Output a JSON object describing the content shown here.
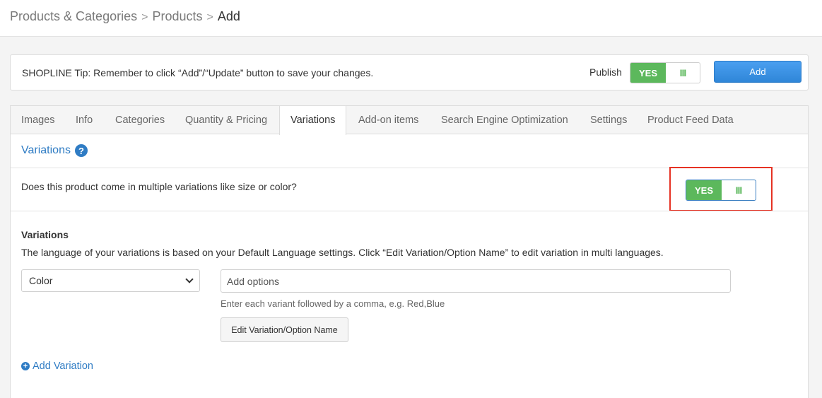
{
  "breadcrumb": {
    "items": [
      "Products & Categories",
      "Products"
    ],
    "current": "Add",
    "separator": ">"
  },
  "tip_bar": {
    "text": "SHOPLINE Tip: Remember to click “Add”/“Update” button to save your changes.",
    "publish_label": "Publish",
    "publish_toggle": {
      "on_label": "YES",
      "handle": "III",
      "state": "on"
    },
    "add_button": "Add"
  },
  "tabs": [
    {
      "label": "Images"
    },
    {
      "label": "Info"
    },
    {
      "label": "Categories"
    },
    {
      "label": "Quantity & Pricing"
    },
    {
      "label": "Variations",
      "active": true
    },
    {
      "label": "Add-on items"
    },
    {
      "label": "Search Engine Optimization"
    },
    {
      "label": "Settings"
    },
    {
      "label": "Product Feed Data"
    }
  ],
  "variations_section": {
    "title": "Variations",
    "help_icon": "?",
    "question": "Does this product come in multiple variations like size or color?",
    "toggle": {
      "on_label": "YES",
      "handle": "III",
      "state": "on"
    },
    "label": "Variations",
    "description": "The language of your variations is based on your Default Language settings. Click “Edit Variation/Option Name” to edit variation in multi languages.",
    "select_value": "Color",
    "options_placeholder": "Add options",
    "hint": "Enter each variant followed by a comma, e.g. Red,Blue",
    "edit_button": "Edit Variation/Option Name",
    "add_variation": "Add Variation",
    "add_icon": "+"
  },
  "colors": {
    "accent_blue": "#2f7cc4",
    "toggle_green": "#5cb85c",
    "highlight_red": "#e63223",
    "add_button_blue": "#3b8fdd"
  }
}
